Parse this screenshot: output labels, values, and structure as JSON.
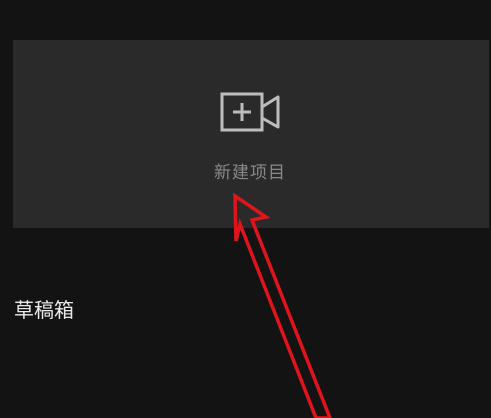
{
  "new_project": {
    "label": "新建项目",
    "icon": "video-camera-plus-icon"
  },
  "drafts": {
    "title": "草稿箱"
  },
  "annotation": {
    "icon": "red-arrow",
    "color": "#e0141c"
  },
  "colors": {
    "background": "#131313",
    "card": "#2a2a2a",
    "icon_stroke": "#bdbdbd",
    "label_text": "#8a8a8a",
    "title_text": "#eaeaea"
  }
}
